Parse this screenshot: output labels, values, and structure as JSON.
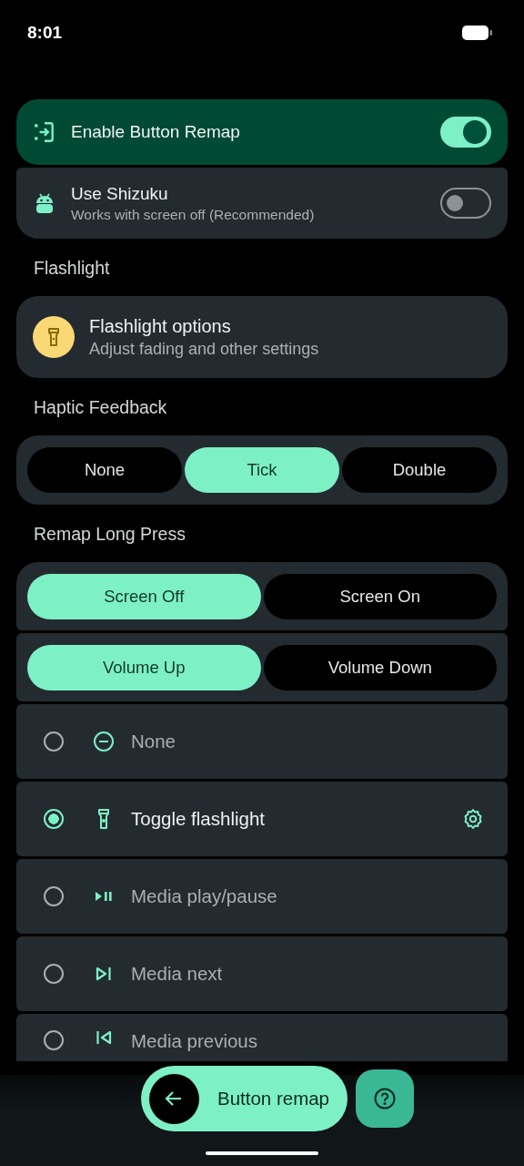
{
  "status_bar": {
    "time": "8:01"
  },
  "enable_remap": {
    "label": "Enable Button Remap",
    "on": true
  },
  "shizuku": {
    "label": "Use Shizuku",
    "sublabel": "Works with screen off (Recommended)",
    "on": false
  },
  "flashlight_section": {
    "heading": "Flashlight",
    "card": {
      "title": "Flashlight options",
      "subtitle": "Adjust fading and other settings"
    }
  },
  "haptic_section": {
    "heading": "Haptic Feedback",
    "segments": [
      {
        "label": "None",
        "selected": false
      },
      {
        "label": "Tick",
        "selected": true
      },
      {
        "label": "Double",
        "selected": false
      }
    ]
  },
  "remap_section": {
    "heading": "Remap Long Press",
    "screen_state": [
      {
        "label": "Screen Off",
        "selected": true
      },
      {
        "label": "Screen On",
        "selected": false
      }
    ],
    "volume_key": [
      {
        "label": "Volume Up",
        "selected": true
      },
      {
        "label": "Volume Down",
        "selected": false
      }
    ],
    "actions": [
      {
        "label": "None",
        "kind": "none",
        "selected": false,
        "has_settings": false
      },
      {
        "label": "Toggle flashlight",
        "kind": "flashlight",
        "selected": true,
        "has_settings": true
      },
      {
        "label": "Media play/pause",
        "kind": "play_pause",
        "selected": false,
        "has_settings": false
      },
      {
        "label": "Media next",
        "kind": "next",
        "selected": false,
        "has_settings": false
      },
      {
        "label": "Media previous",
        "kind": "previous",
        "selected": false,
        "has_settings": false
      }
    ]
  },
  "bottom_bar": {
    "title": "Button remap"
  }
}
